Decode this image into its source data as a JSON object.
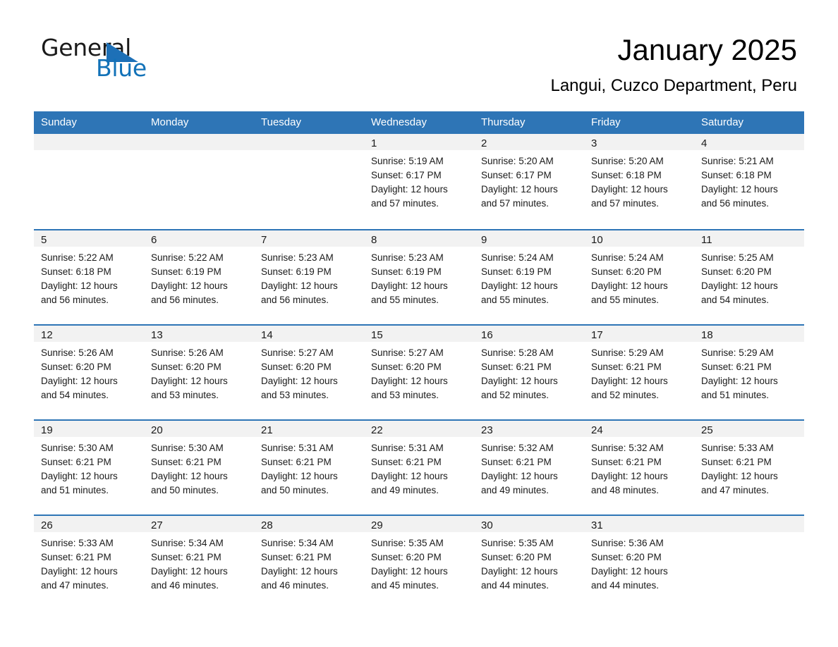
{
  "logo": {
    "line1": "General",
    "line2": "Blue",
    "triangle_color": "#1d70b7",
    "line2_color": "#1272b8"
  },
  "header": {
    "title": "January 2025",
    "subtitle": "Langui, Cuzco Department, Peru"
  },
  "theme": {
    "header_blue": "#2e75b6",
    "day_band_gray": "#f2f2f2",
    "text": "#1a1a1a"
  },
  "weekday_headers": [
    "Sunday",
    "Monday",
    "Tuesday",
    "Wednesday",
    "Thursday",
    "Friday",
    "Saturday"
  ],
  "labels": {
    "sunrise_prefix": "Sunrise:",
    "sunset_prefix": "Sunset:",
    "daylight_prefix": "Daylight:"
  },
  "weeks": [
    [
      {
        "blank": true
      },
      {
        "blank": true
      },
      {
        "blank": true
      },
      {
        "day": "1",
        "sunrise": "Sunrise: 5:19 AM",
        "sunset": "Sunset: 6:17 PM",
        "daylight_line1": "Daylight: 12 hours",
        "daylight_line2": "and 57 minutes."
      },
      {
        "day": "2",
        "sunrise": "Sunrise: 5:20 AM",
        "sunset": "Sunset: 6:17 PM",
        "daylight_line1": "Daylight: 12 hours",
        "daylight_line2": "and 57 minutes."
      },
      {
        "day": "3",
        "sunrise": "Sunrise: 5:20 AM",
        "sunset": "Sunset: 6:18 PM",
        "daylight_line1": "Daylight: 12 hours",
        "daylight_line2": "and 57 minutes."
      },
      {
        "day": "4",
        "sunrise": "Sunrise: 5:21 AM",
        "sunset": "Sunset: 6:18 PM",
        "daylight_line1": "Daylight: 12 hours",
        "daylight_line2": "and 56 minutes."
      }
    ],
    [
      {
        "day": "5",
        "sunrise": "Sunrise: 5:22 AM",
        "sunset": "Sunset: 6:18 PM",
        "daylight_line1": "Daylight: 12 hours",
        "daylight_line2": "and 56 minutes."
      },
      {
        "day": "6",
        "sunrise": "Sunrise: 5:22 AM",
        "sunset": "Sunset: 6:19 PM",
        "daylight_line1": "Daylight: 12 hours",
        "daylight_line2": "and 56 minutes."
      },
      {
        "day": "7",
        "sunrise": "Sunrise: 5:23 AM",
        "sunset": "Sunset: 6:19 PM",
        "daylight_line1": "Daylight: 12 hours",
        "daylight_line2": "and 56 minutes."
      },
      {
        "day": "8",
        "sunrise": "Sunrise: 5:23 AM",
        "sunset": "Sunset: 6:19 PM",
        "daylight_line1": "Daylight: 12 hours",
        "daylight_line2": "and 55 minutes."
      },
      {
        "day": "9",
        "sunrise": "Sunrise: 5:24 AM",
        "sunset": "Sunset: 6:19 PM",
        "daylight_line1": "Daylight: 12 hours",
        "daylight_line2": "and 55 minutes."
      },
      {
        "day": "10",
        "sunrise": "Sunrise: 5:24 AM",
        "sunset": "Sunset: 6:20 PM",
        "daylight_line1": "Daylight: 12 hours",
        "daylight_line2": "and 55 minutes."
      },
      {
        "day": "11",
        "sunrise": "Sunrise: 5:25 AM",
        "sunset": "Sunset: 6:20 PM",
        "daylight_line1": "Daylight: 12 hours",
        "daylight_line2": "and 54 minutes."
      }
    ],
    [
      {
        "day": "12",
        "sunrise": "Sunrise: 5:26 AM",
        "sunset": "Sunset: 6:20 PM",
        "daylight_line1": "Daylight: 12 hours",
        "daylight_line2": "and 54 minutes."
      },
      {
        "day": "13",
        "sunrise": "Sunrise: 5:26 AM",
        "sunset": "Sunset: 6:20 PM",
        "daylight_line1": "Daylight: 12 hours",
        "daylight_line2": "and 53 minutes."
      },
      {
        "day": "14",
        "sunrise": "Sunrise: 5:27 AM",
        "sunset": "Sunset: 6:20 PM",
        "daylight_line1": "Daylight: 12 hours",
        "daylight_line2": "and 53 minutes."
      },
      {
        "day": "15",
        "sunrise": "Sunrise: 5:27 AM",
        "sunset": "Sunset: 6:20 PM",
        "daylight_line1": "Daylight: 12 hours",
        "daylight_line2": "and 53 minutes."
      },
      {
        "day": "16",
        "sunrise": "Sunrise: 5:28 AM",
        "sunset": "Sunset: 6:21 PM",
        "daylight_line1": "Daylight: 12 hours",
        "daylight_line2": "and 52 minutes."
      },
      {
        "day": "17",
        "sunrise": "Sunrise: 5:29 AM",
        "sunset": "Sunset: 6:21 PM",
        "daylight_line1": "Daylight: 12 hours",
        "daylight_line2": "and 52 minutes."
      },
      {
        "day": "18",
        "sunrise": "Sunrise: 5:29 AM",
        "sunset": "Sunset: 6:21 PM",
        "daylight_line1": "Daylight: 12 hours",
        "daylight_line2": "and 51 minutes."
      }
    ],
    [
      {
        "day": "19",
        "sunrise": "Sunrise: 5:30 AM",
        "sunset": "Sunset: 6:21 PM",
        "daylight_line1": "Daylight: 12 hours",
        "daylight_line2": "and 51 minutes."
      },
      {
        "day": "20",
        "sunrise": "Sunrise: 5:30 AM",
        "sunset": "Sunset: 6:21 PM",
        "daylight_line1": "Daylight: 12 hours",
        "daylight_line2": "and 50 minutes."
      },
      {
        "day": "21",
        "sunrise": "Sunrise: 5:31 AM",
        "sunset": "Sunset: 6:21 PM",
        "daylight_line1": "Daylight: 12 hours",
        "daylight_line2": "and 50 minutes."
      },
      {
        "day": "22",
        "sunrise": "Sunrise: 5:31 AM",
        "sunset": "Sunset: 6:21 PM",
        "daylight_line1": "Daylight: 12 hours",
        "daylight_line2": "and 49 minutes."
      },
      {
        "day": "23",
        "sunrise": "Sunrise: 5:32 AM",
        "sunset": "Sunset: 6:21 PM",
        "daylight_line1": "Daylight: 12 hours",
        "daylight_line2": "and 49 minutes."
      },
      {
        "day": "24",
        "sunrise": "Sunrise: 5:32 AM",
        "sunset": "Sunset: 6:21 PM",
        "daylight_line1": "Daylight: 12 hours",
        "daylight_line2": "and 48 minutes."
      },
      {
        "day": "25",
        "sunrise": "Sunrise: 5:33 AM",
        "sunset": "Sunset: 6:21 PM",
        "daylight_line1": "Daylight: 12 hours",
        "daylight_line2": "and 47 minutes."
      }
    ],
    [
      {
        "day": "26",
        "sunrise": "Sunrise: 5:33 AM",
        "sunset": "Sunset: 6:21 PM",
        "daylight_line1": "Daylight: 12 hours",
        "daylight_line2": "and 47 minutes."
      },
      {
        "day": "27",
        "sunrise": "Sunrise: 5:34 AM",
        "sunset": "Sunset: 6:21 PM",
        "daylight_line1": "Daylight: 12 hours",
        "daylight_line2": "and 46 minutes."
      },
      {
        "day": "28",
        "sunrise": "Sunrise: 5:34 AM",
        "sunset": "Sunset: 6:21 PM",
        "daylight_line1": "Daylight: 12 hours",
        "daylight_line2": "and 46 minutes."
      },
      {
        "day": "29",
        "sunrise": "Sunrise: 5:35 AM",
        "sunset": "Sunset: 6:20 PM",
        "daylight_line1": "Daylight: 12 hours",
        "daylight_line2": "and 45 minutes."
      },
      {
        "day": "30",
        "sunrise": "Sunrise: 5:35 AM",
        "sunset": "Sunset: 6:20 PM",
        "daylight_line1": "Daylight: 12 hours",
        "daylight_line2": "and 44 minutes."
      },
      {
        "day": "31",
        "sunrise": "Sunrise: 5:36 AM",
        "sunset": "Sunset: 6:20 PM",
        "daylight_line1": "Daylight: 12 hours",
        "daylight_line2": "and 44 minutes."
      },
      {
        "blank": true
      }
    ]
  ]
}
